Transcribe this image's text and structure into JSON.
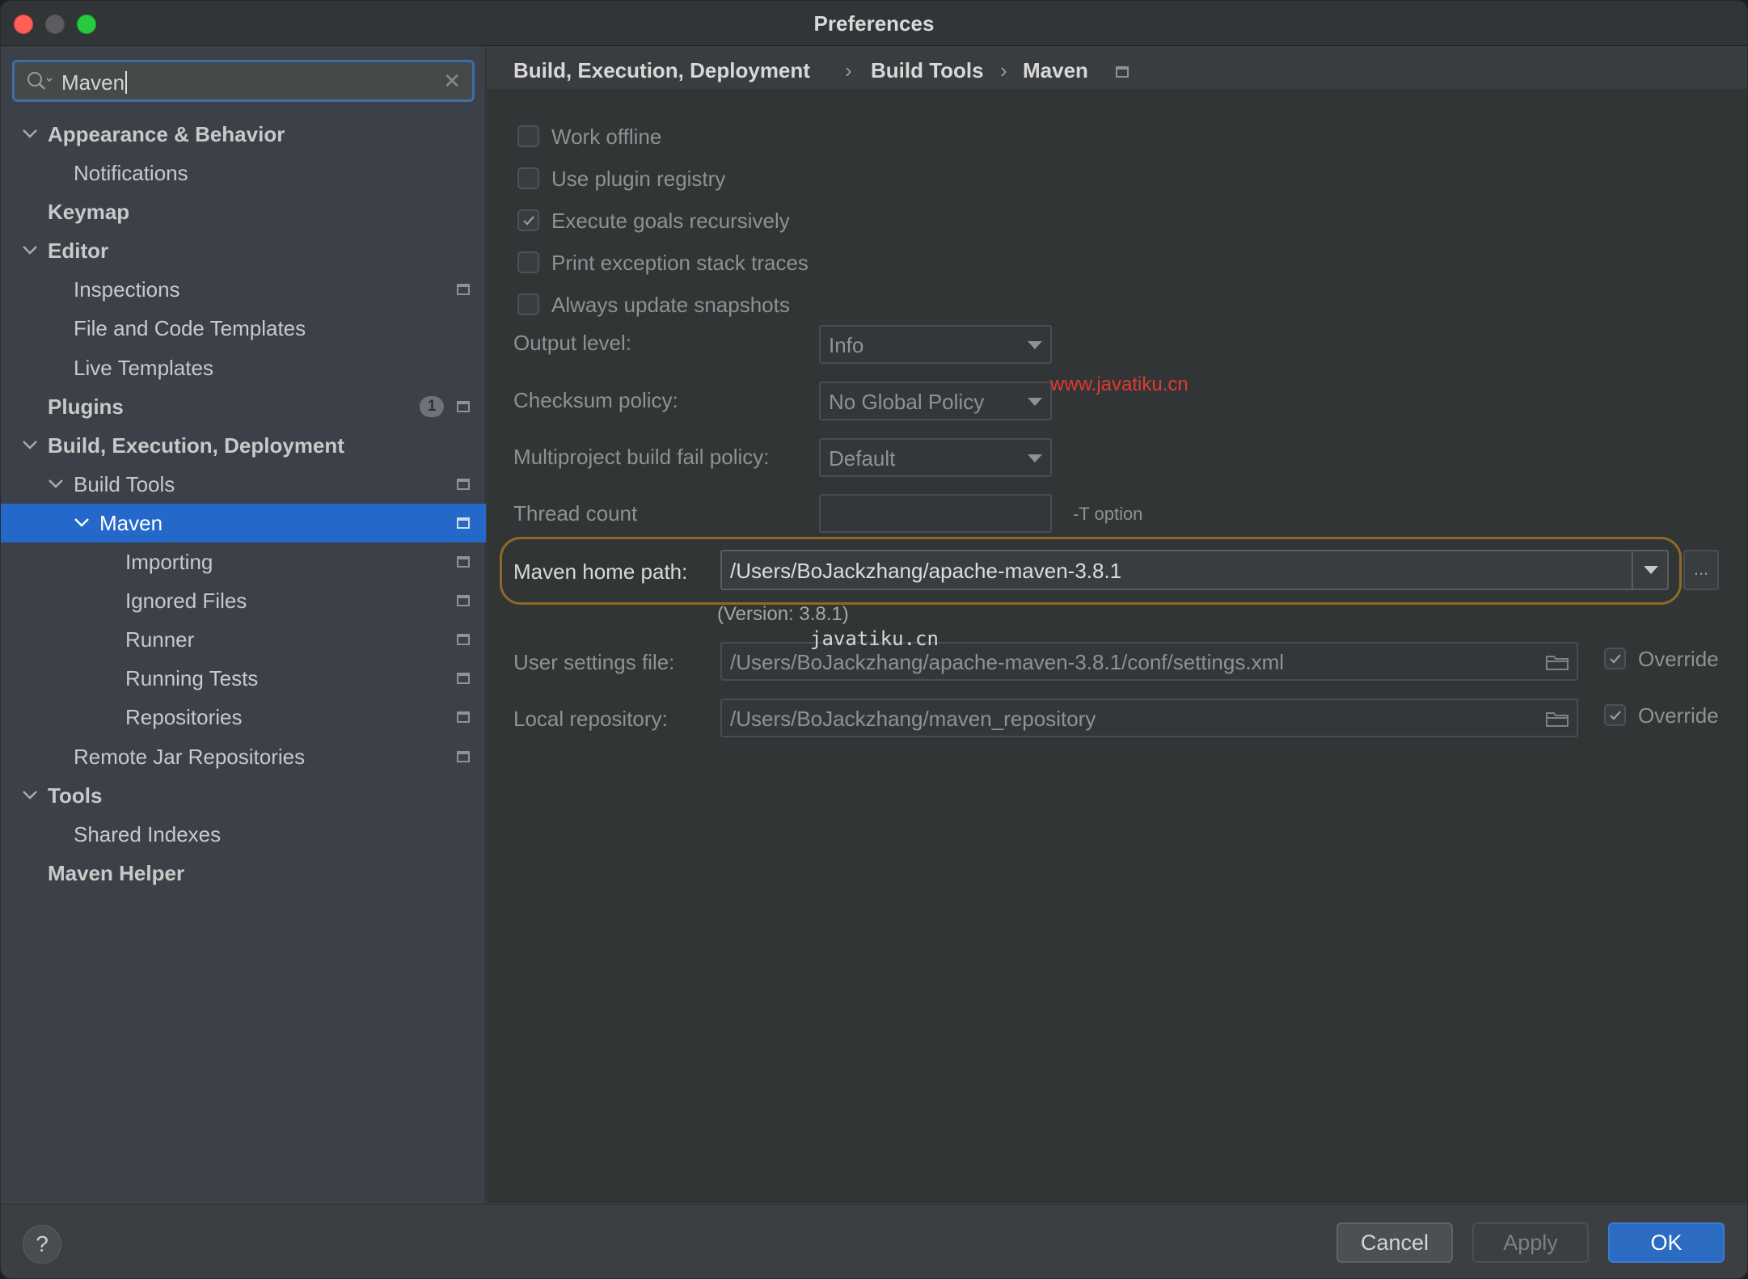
{
  "window": {
    "title": "Preferences"
  },
  "search": {
    "value": "Maven"
  },
  "sidebar": {
    "items": [
      {
        "label": "Appearance & Behavior",
        "level": 0,
        "bold": true,
        "expanded": true
      },
      {
        "label": "Notifications",
        "level": 1
      },
      {
        "label": "Keymap",
        "level": 0,
        "bold": true
      },
      {
        "label": "Editor",
        "level": 0,
        "bold": true,
        "expanded": true
      },
      {
        "label": "Inspections",
        "level": 1,
        "project_icon": true
      },
      {
        "label": "File and Code Templates",
        "level": 1
      },
      {
        "label": "Live Templates",
        "level": 1
      },
      {
        "label": "Plugins",
        "level": 0,
        "bold": true,
        "badge": "1",
        "project_icon": true
      },
      {
        "label": "Build, Execution, Deployment",
        "level": 0,
        "bold": true,
        "expanded": true
      },
      {
        "label": "Build Tools",
        "level": 1,
        "expanded": true,
        "project_icon": true
      },
      {
        "label": "Maven",
        "level": 2,
        "expanded": true,
        "selected": true,
        "project_icon": true
      },
      {
        "label": "Importing",
        "level": 3,
        "project_icon": true
      },
      {
        "label": "Ignored Files",
        "level": 3,
        "project_icon": true
      },
      {
        "label": "Runner",
        "level": 3,
        "project_icon": true
      },
      {
        "label": "Running Tests",
        "level": 3,
        "project_icon": true
      },
      {
        "label": "Repositories",
        "level": 3,
        "project_icon": true
      },
      {
        "label": "Remote Jar Repositories",
        "level": 1,
        "project_icon": true
      },
      {
        "label": "Tools",
        "level": 0,
        "bold": true,
        "expanded": true
      },
      {
        "label": "Shared Indexes",
        "level": 1
      },
      {
        "label": "Maven Helper",
        "level": 0,
        "bold": true
      }
    ]
  },
  "breadcrumb": {
    "items": [
      "Build, Execution, Deployment",
      "Build Tools",
      "Maven"
    ],
    "separator": "›"
  },
  "options": [
    {
      "label": "Work offline",
      "checked": false
    },
    {
      "label": "Use plugin registry",
      "checked": false
    },
    {
      "label": "Execute goals recursively",
      "checked": true
    },
    {
      "label": "Print exception stack traces",
      "checked": false
    },
    {
      "label": "Always update snapshots",
      "checked": false
    }
  ],
  "form": {
    "output_level_label": "Output level:",
    "output_level_value": "Info",
    "checksum_label": "Checksum policy:",
    "checksum_value": "No Global Policy",
    "multiproject_label": "Multiproject build fail policy:",
    "multiproject_value": "Default",
    "thread_count_label": "Thread count",
    "thread_count_value": "",
    "thread_count_hint": "-T option",
    "maven_home_label": "Maven home path:",
    "maven_home_value": "/Users/BoJackzhang/apache-maven-3.8.1",
    "browse_label": "...",
    "version_text": "(Version: 3.8.1)",
    "user_settings_label": "User settings file:",
    "user_settings_value": "/Users/BoJackzhang/apache-maven-3.8.1/conf/settings.xml",
    "user_settings_override_label": "Override",
    "user_settings_override": true,
    "local_repo_label": "Local repository:",
    "local_repo_value": "/Users/BoJackzhang/maven_repository",
    "local_repo_override_label": "Override",
    "local_repo_override": true
  },
  "watermarks": {
    "red": "www.javatiku.cn",
    "mono": "javatiku.cn"
  },
  "footer": {
    "help_label": "?",
    "cancel_label": "Cancel",
    "apply_label": "Apply",
    "ok_label": "OK"
  },
  "colors": {
    "selection": "#2468c9",
    "primary_button": "#2b6bc2",
    "highlight_outline": "#8c6b24",
    "watermark_red": "#e03a30"
  }
}
